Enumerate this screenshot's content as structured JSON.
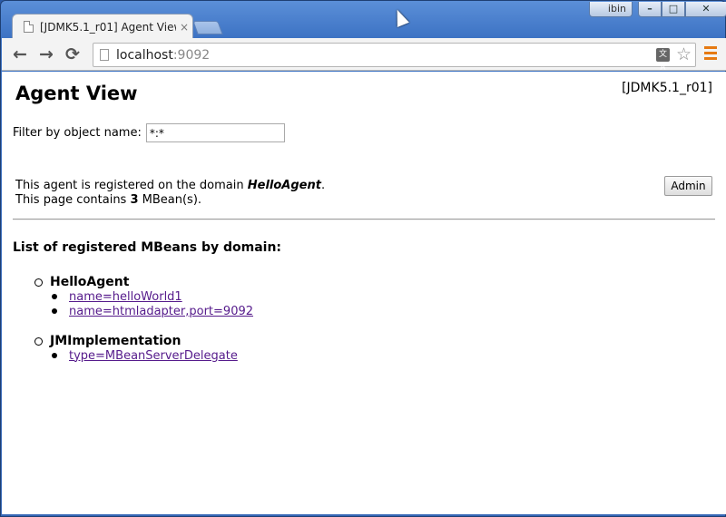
{
  "window": {
    "user_label": "ibin",
    "controls": {
      "minimize": "–",
      "maximize": "□",
      "close": "✕"
    }
  },
  "tab": {
    "title": "[JDMK5.1_r01] Agent View",
    "close": "×"
  },
  "toolbar": {
    "back": "←",
    "forward": "→",
    "reload": "⟳",
    "url_host": "localhost",
    "url_port": ":9092",
    "translate": "文A",
    "star": "☆"
  },
  "page": {
    "title": "Agent View",
    "version": "[JDMK5.1_r01]",
    "filter_label": "Filter by object name:",
    "filter_value": "*:*",
    "info_prefix": "This agent is registered on the domain ",
    "info_domain": "HelloAgent",
    "info_suffix": ".",
    "count_prefix": "This page contains ",
    "count_value": "3",
    "count_suffix": " MBean(s).",
    "admin_button": "Admin",
    "list_heading": "List of registered MBeans by domain:",
    "domains": [
      {
        "name": "HelloAgent",
        "mbeans": [
          "name=helloWorld1",
          "name=htmladapter,port=9092"
        ]
      },
      {
        "name": "JMImplementation",
        "mbeans": [
          "type=MBeanServerDelegate"
        ]
      }
    ]
  }
}
